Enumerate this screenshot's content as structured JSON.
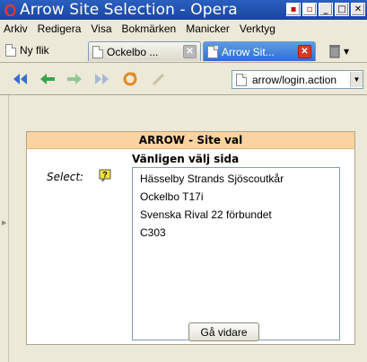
{
  "window": {
    "title": "Arrow Site Selection - Opera",
    "buttons": [
      "▪",
      "□",
      "▫",
      "✕"
    ]
  },
  "menu": {
    "items": [
      "Arkiv",
      "Redigera",
      "Visa",
      "Bokmärken",
      "Manicker",
      "Verktyg"
    ]
  },
  "tabs": {
    "new_tab_label": "Ny flik",
    "items": [
      {
        "label": "Ockelbo ...",
        "active": false
      },
      {
        "label": "Arrow Sit...",
        "active": true
      }
    ]
  },
  "address": {
    "value": "arrow/login.action"
  },
  "page": {
    "header": "ARROW - Site val",
    "instruction": "Vänligen välj sida",
    "select_label": "Select:",
    "sites": [
      "Hässelby Strands Sjöscoutkår",
      "Ockelbo T17i",
      "Svenska Rival 22 förbundet",
      "C303"
    ],
    "submit_label": "Gå vidare"
  },
  "colors": {
    "titlebar": "#1e4fa8",
    "panel_header": "#fad3a0",
    "active_tab": "#2f6fd0"
  }
}
